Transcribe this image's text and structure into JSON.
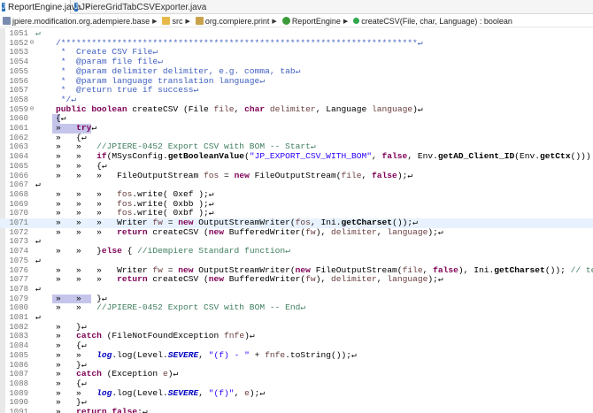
{
  "tabs": [
    {
      "label": "ReportEngine.java",
      "close": "×",
      "active": true
    },
    {
      "label": "JPiereGridTabCSVExporter.java",
      "active": false
    }
  ],
  "breadcrumb": [
    {
      "label": "jpiere.modification.org.adempiere.base",
      "icon": "project-icon"
    },
    {
      "label": "src",
      "icon": "source-folder-icon"
    },
    {
      "label": "org.compiere.print",
      "icon": "package-icon"
    },
    {
      "label": "ReportEngine",
      "icon": "class-icon"
    },
    {
      "label": "createCSV(File, char, Language) : boolean",
      "icon": "method-icon"
    }
  ],
  "colors": {
    "comment": "#3f7f5f",
    "javadoc": "#3f5fbf",
    "keyword": "#7f0055",
    "string": "#2a00ff",
    "field": "#0000c0",
    "current_line": "#e8f2fe",
    "bracket_highlight": "#c5c5ec"
  },
  "lines": [
    {
      "n": "1051",
      "fold": "",
      "parts": [
        {
          "t": "↵",
          "k": "c"
        }
      ]
    },
    {
      "n": "1052",
      "fold": "⊖",
      "parts": [
        {
          "t": "    /**********************************************************************↵",
          "k": "jd"
        }
      ]
    },
    {
      "n": "1053",
      "fold": "",
      "parts": [
        {
          "t": "     *  Create CSV File↵",
          "k": "jd"
        }
      ]
    },
    {
      "n": "1054",
      "fold": "",
      "parts": [
        {
          "t": "     *  @param file file↵",
          "k": "jd"
        }
      ]
    },
    {
      "n": "1055",
      "fold": "",
      "parts": [
        {
          "t": "     *  @param delimiter delimiter, e.g. comma, tab↵",
          "k": "jd"
        }
      ]
    },
    {
      "n": "1056",
      "fold": "",
      "parts": [
        {
          "t": "     *  @param language translation language↵",
          "k": "jd"
        }
      ]
    },
    {
      "n": "1057",
      "fold": "",
      "parts": [
        {
          "t": "     *  @return true if success↵",
          "k": "jd"
        }
      ]
    },
    {
      "n": "1058",
      "fold": "",
      "parts": [
        {
          "t": "     */↵",
          "k": "jd"
        }
      ]
    },
    {
      "n": "1059",
      "fold": "⊖",
      "parts": [
        {
          "t": "    ",
          "k": "m"
        },
        {
          "t": "public boolean",
          "k": "kw"
        },
        {
          "t": " createCSV (File ",
          "k": "m"
        },
        {
          "t": "file",
          "k": "par"
        },
        {
          "t": ", ",
          "k": "m"
        },
        {
          "t": "char",
          "k": "kw"
        },
        {
          "t": " ",
          "k": "m"
        },
        {
          "t": "delimiter",
          "k": "par"
        },
        {
          "t": ", Language ",
          "k": "m"
        },
        {
          "t": "language",
          "k": "par"
        },
        {
          "t": ")↵",
          "k": "m"
        }
      ]
    },
    {
      "n": "1060",
      "fold": "",
      "hl": [
        {
          "x": 19,
          "w": 9
        }
      ],
      "parts": [
        {
          "t": "    {↵",
          "k": "m"
        }
      ]
    },
    {
      "n": "1061",
      "fold": "",
      "hl": [
        {
          "x": 19,
          "w": 44
        }
      ],
      "parts": [
        {
          "t": "    »   ",
          "k": "m"
        },
        {
          "t": "try",
          "k": "kw"
        },
        {
          "t": "↵",
          "k": "m"
        }
      ]
    },
    {
      "n": "1062",
      "fold": "",
      "parts": [
        {
          "t": "    »   {↵",
          "k": "m"
        }
      ]
    },
    {
      "n": "1063",
      "fold": "",
      "parts": [
        {
          "t": "    »   »   ",
          "k": "m"
        },
        {
          "t": "//JPIERE-0452 Export CSV with BOM -- Start↵",
          "k": "c"
        }
      ]
    },
    {
      "n": "1064",
      "fold": "",
      "parts": [
        {
          "t": "    »   »   ",
          "k": "m"
        },
        {
          "t": "if",
          "k": "kw"
        },
        {
          "t": "(MSysConfig.",
          "k": "m"
        },
        {
          "t": "getBooleanValue",
          "k": "b"
        },
        {
          "t": "(",
          "k": "m"
        },
        {
          "t": "\"JP_EXPORT_CSV_WITH_BOM\"",
          "k": "str"
        },
        {
          "t": ", ",
          "k": "m"
        },
        {
          "t": "false",
          "k": "kw"
        },
        {
          "t": ", Env.",
          "k": "m"
        },
        {
          "t": "getAD_Client_ID",
          "k": "b"
        },
        {
          "t": "(Env.",
          "k": "m"
        },
        {
          "t": "getCtx",
          "k": "b"
        },
        {
          "t": "()))",
          "k": "m"
        }
      ]
    },
    {
      "n": "1065",
      "fold": "",
      "parts": [
        {
          "t": "    »   »   {↵",
          "k": "m"
        }
      ]
    },
    {
      "n": "1066",
      "fold": "",
      "parts": [
        {
          "t": "    »   »   »   FileOutputStream ",
          "k": "m"
        },
        {
          "t": "fos",
          "k": "loc"
        },
        {
          "t": " = ",
          "k": "m"
        },
        {
          "t": "new",
          "k": "kw"
        },
        {
          "t": " FileOutputStream(",
          "k": "m"
        },
        {
          "t": "file",
          "k": "par"
        },
        {
          "t": ", ",
          "k": "m"
        },
        {
          "t": "false",
          "k": "kw"
        },
        {
          "t": ");↵",
          "k": "m"
        }
      ]
    },
    {
      "n": "1067",
      "fold": "",
      "parts": [
        {
          "t": "↵",
          "k": "m"
        }
      ]
    },
    {
      "n": "1068",
      "fold": "",
      "parts": [
        {
          "t": "    »   »   »   ",
          "k": "m"
        },
        {
          "t": "fos",
          "k": "loc"
        },
        {
          "t": ".write( 0xef );↵",
          "k": "m"
        }
      ]
    },
    {
      "n": "1069",
      "fold": "",
      "parts": [
        {
          "t": "    »   »   »   ",
          "k": "m"
        },
        {
          "t": "fos",
          "k": "loc"
        },
        {
          "t": ".write( 0xbb );↵",
          "k": "m"
        }
      ]
    },
    {
      "n": "1070",
      "fold": "",
      "parts": [
        {
          "t": "    »   »   »   ",
          "k": "m"
        },
        {
          "t": "fos",
          "k": "loc"
        },
        {
          "t": ".write( 0xbf );↵",
          "k": "m"
        }
      ]
    },
    {
      "n": "1071",
      "fold": "",
      "cur": true,
      "parts": [
        {
          "t": "    »   »   »   Writer ",
          "k": "m"
        },
        {
          "t": "fw",
          "k": "loc"
        },
        {
          "t": " = ",
          "k": "m"
        },
        {
          "t": "new",
          "k": "kw"
        },
        {
          "t": " OutputStreamWriter(",
          "k": "m"
        },
        {
          "t": "fos",
          "k": "loc"
        },
        {
          "t": ", Ini.",
          "k": "m"
        },
        {
          "t": "getCharset",
          "k": "b"
        },
        {
          "t": "());↵",
          "k": "m"
        }
      ]
    },
    {
      "n": "1072",
      "fold": "",
      "parts": [
        {
          "t": "    »   »   »   ",
          "k": "m"
        },
        {
          "t": "return",
          "k": "kw"
        },
        {
          "t": " createCSV (",
          "k": "m"
        },
        {
          "t": "new",
          "k": "kw"
        },
        {
          "t": " BufferedWriter(",
          "k": "m"
        },
        {
          "t": "fw",
          "k": "loc"
        },
        {
          "t": "), ",
          "k": "m"
        },
        {
          "t": "delimiter",
          "k": "par"
        },
        {
          "t": ", ",
          "k": "m"
        },
        {
          "t": "language",
          "k": "par"
        },
        {
          "t": ");↵",
          "k": "m"
        }
      ]
    },
    {
      "n": "1073",
      "fold": "",
      "parts": [
        {
          "t": "↵",
          "k": "m"
        }
      ]
    },
    {
      "n": "1074",
      "fold": "",
      "parts": [
        {
          "t": "    »   »   }",
          "k": "m"
        },
        {
          "t": "else",
          "k": "kw"
        },
        {
          "t": " { ",
          "k": "m"
        },
        {
          "t": "//iDempiere Standard function↵",
          "k": "c"
        }
      ]
    },
    {
      "n": "1075",
      "fold": "",
      "parts": [
        {
          "t": "↵",
          "k": "m"
        }
      ]
    },
    {
      "n": "1076",
      "fold": "",
      "parts": [
        {
          "t": "    »   »   »   Writer ",
          "k": "m"
        },
        {
          "t": "fw",
          "k": "loc"
        },
        {
          "t": " = ",
          "k": "m"
        },
        {
          "t": "new",
          "k": "kw"
        },
        {
          "t": " OutputStreamWriter(",
          "k": "m"
        },
        {
          "t": "new",
          "k": "kw"
        },
        {
          "t": " FileOutputStream(",
          "k": "m"
        },
        {
          "t": "file",
          "k": "par"
        },
        {
          "t": ", ",
          "k": "m"
        },
        {
          "t": "false",
          "k": "kw"
        },
        {
          "t": "), Ini.",
          "k": "m"
        },
        {
          "t": "getCharset",
          "k": "b"
        },
        {
          "t": "()); ",
          "k": "m"
        },
        {
          "t": "// teo_s",
          "k": "c"
        }
      ]
    },
    {
      "n": "1077",
      "fold": "",
      "parts": [
        {
          "t": "    »   »   »   ",
          "k": "m"
        },
        {
          "t": "return",
          "k": "kw"
        },
        {
          "t": " createCSV (",
          "k": "m"
        },
        {
          "t": "new",
          "k": "kw"
        },
        {
          "t": " BufferedWriter(",
          "k": "m"
        },
        {
          "t": "fw",
          "k": "loc"
        },
        {
          "t": "), ",
          "k": "m"
        },
        {
          "t": "delimiter",
          "k": "par"
        },
        {
          "t": ", ",
          "k": "m"
        },
        {
          "t": "language",
          "k": "par"
        },
        {
          "t": ");↵",
          "k": "m"
        }
      ]
    },
    {
      "n": "1078",
      "fold": "",
      "parts": [
        {
          "t": "↵",
          "k": "m"
        }
      ]
    },
    {
      "n": "1079",
      "fold": "",
      "hl": [
        {
          "x": 19,
          "w": 44
        }
      ],
      "parts": [
        {
          "t": "    »   »   }↵",
          "k": "m"
        }
      ]
    },
    {
      "n": "1080",
      "fold": "",
      "parts": [
        {
          "t": "    »   »   ",
          "k": "m"
        },
        {
          "t": "//JPIERE-0452 Export CSV with BOM -- End↵",
          "k": "c"
        }
      ]
    },
    {
      "n": "1081",
      "fold": "",
      "parts": [
        {
          "t": "↵",
          "k": "m"
        }
      ]
    },
    {
      "n": "1082",
      "fold": "",
      "parts": [
        {
          "t": "    »   }↵",
          "k": "m"
        }
      ]
    },
    {
      "n": "1083",
      "fold": "",
      "parts": [
        {
          "t": "    »   ",
          "k": "m"
        },
        {
          "t": "catch",
          "k": "kw"
        },
        {
          "t": " (FileNotFoundException ",
          "k": "m"
        },
        {
          "t": "fnfe",
          "k": "loc"
        },
        {
          "t": ")↵",
          "k": "m"
        }
      ]
    },
    {
      "n": "1084",
      "fold": "",
      "parts": [
        {
          "t": "    »   {↵",
          "k": "m"
        }
      ]
    },
    {
      "n": "1085",
      "fold": "",
      "parts": [
        {
          "t": "    »   »   ",
          "k": "m"
        },
        {
          "t": "log",
          "k": "fld"
        },
        {
          "t": ".log(Level.",
          "k": "m"
        },
        {
          "t": "SEVERE",
          "k": "fld"
        },
        {
          "t": ", ",
          "k": "m"
        },
        {
          "t": "\"(f) - \"",
          "k": "str"
        },
        {
          "t": " + ",
          "k": "m"
        },
        {
          "t": "fnfe",
          "k": "loc"
        },
        {
          "t": ".toString());↵",
          "k": "m"
        }
      ]
    },
    {
      "n": "1086",
      "fold": "",
      "parts": [
        {
          "t": "    »   }↵",
          "k": "m"
        }
      ]
    },
    {
      "n": "1087",
      "fold": "",
      "parts": [
        {
          "t": "    »   ",
          "k": "m"
        },
        {
          "t": "catch",
          "k": "kw"
        },
        {
          "t": " (Exception ",
          "k": "m"
        },
        {
          "t": "e",
          "k": "loc"
        },
        {
          "t": ")↵",
          "k": "m"
        }
      ]
    },
    {
      "n": "1088",
      "fold": "",
      "parts": [
        {
          "t": "    »   {↵",
          "k": "m"
        }
      ]
    },
    {
      "n": "1089",
      "fold": "",
      "parts": [
        {
          "t": "    »   »   ",
          "k": "m"
        },
        {
          "t": "log",
          "k": "fld"
        },
        {
          "t": ".log(Level.",
          "k": "m"
        },
        {
          "t": "SEVERE",
          "k": "fld"
        },
        {
          "t": ", ",
          "k": "m"
        },
        {
          "t": "\"(f)\"",
          "k": "str"
        },
        {
          "t": ", ",
          "k": "m"
        },
        {
          "t": "e",
          "k": "loc"
        },
        {
          "t": ");↵",
          "k": "m"
        }
      ]
    },
    {
      "n": "1090",
      "fold": "",
      "parts": [
        {
          "t": "    »   }↵",
          "k": "m"
        }
      ]
    },
    {
      "n": "1091",
      "fold": "",
      "parts": [
        {
          "t": "    »   ",
          "k": "m"
        },
        {
          "t": "return",
          "k": "kw"
        },
        {
          "t": " ",
          "k": "m"
        },
        {
          "t": "false",
          "k": "kw"
        },
        {
          "t": ";↵",
          "k": "m"
        }
      ]
    },
    {
      "n": "1092",
      "fold": "",
      "parts": [
        {
          "t": "    }   ",
          "k": "m"
        },
        {
          "t": "//  createCSV↵",
          "k": "c"
        }
      ]
    }
  ]
}
